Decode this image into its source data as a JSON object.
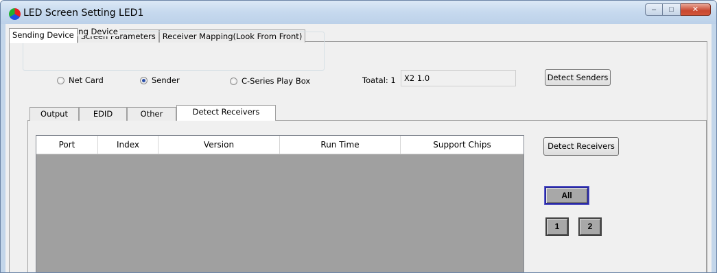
{
  "window": {
    "title": "LED Screen Setting LED1",
    "controls": [
      "–",
      "□",
      "✕"
    ]
  },
  "top_tabs": [
    "Sending Device",
    "Screen Parameters",
    "Receiver Mapping(Look From Front)"
  ],
  "select_device": {
    "group_title": "Select Sending Device",
    "options": [
      "Net Card",
      "Sender",
      "C-Series Play Box"
    ],
    "selected": "Sender"
  },
  "total_label": "Toatal: 1",
  "device_model": "X2 1.0",
  "detect_senders_label": "Detect Senders",
  "inner_tabs": [
    "Output",
    "EDID",
    "Other",
    "Detect Receivers"
  ],
  "receivers_table": {
    "columns": [
      "Port",
      "Index",
      "Version",
      "Run Time",
      "Support Chips"
    ],
    "rows": []
  },
  "detect_receivers_label": "Detect Receivers",
  "port_buttons": {
    "all": "All",
    "ports": [
      "1",
      "2"
    ]
  }
}
